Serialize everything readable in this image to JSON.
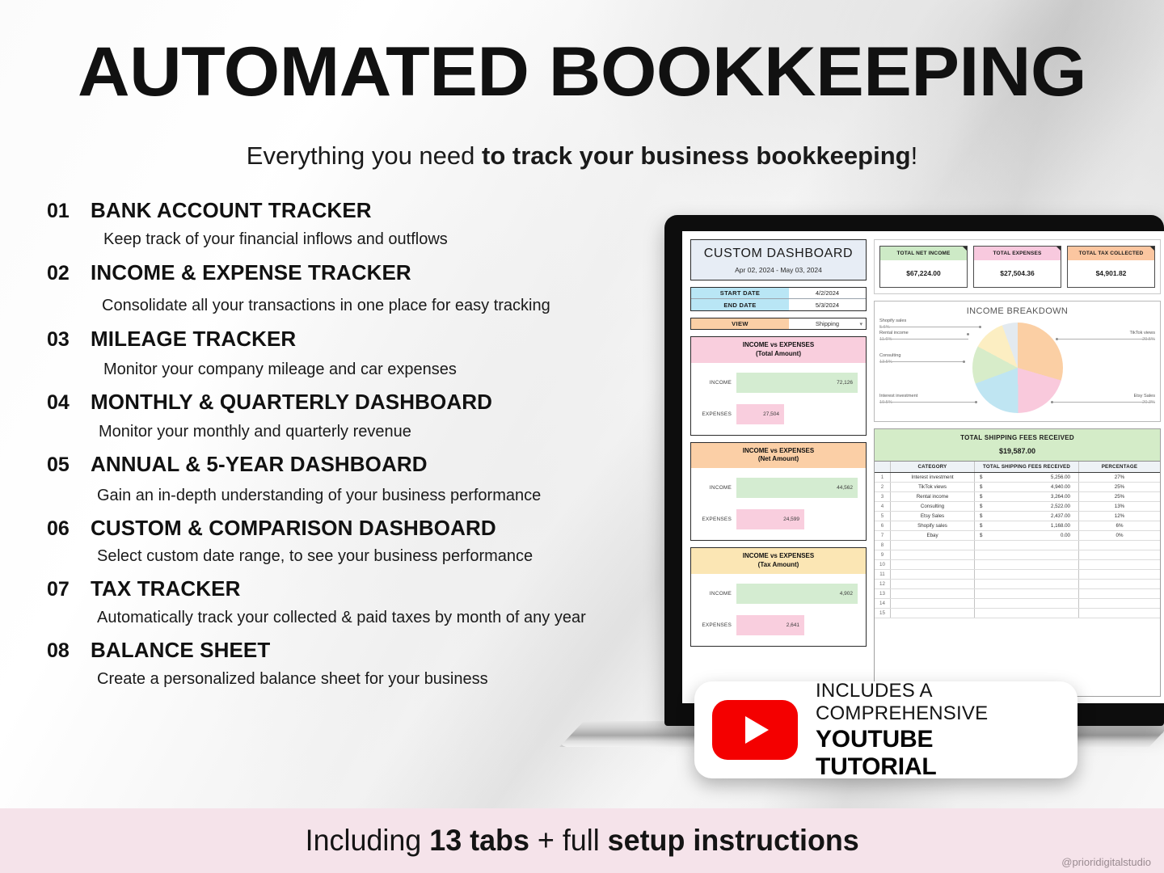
{
  "header": {
    "title": "AUTOMATED BOOKKEEPING",
    "subtitle_plain": "Everything you need ",
    "subtitle_bold": "to track your business bookkeeping",
    "subtitle_end": "!"
  },
  "features": [
    {
      "num": "01",
      "title": "BANK ACCOUNT TRACKER",
      "desc": "Keep track of your financial inflows and outflows"
    },
    {
      "num": "02",
      "title": "INCOME & EXPENSE TRACKER",
      "desc": "Consolidate all your transactions in one place for easy tracking"
    },
    {
      "num": "03",
      "title": "MILEAGE TRACKER",
      "desc": "Monitor your company mileage and car expenses"
    },
    {
      "num": "04",
      "title": "MONTHLY & QUARTERLY DASHBOARD",
      "desc": "Monitor your monthly and quarterly revenue"
    },
    {
      "num": "05",
      "title": "ANNUAL & 5-YEAR DASHBOARD",
      "desc": "Gain an in-depth understanding of your business performance"
    },
    {
      "num": "06",
      "title": "CUSTOM & COMPARISON DASHBOARD",
      "desc": "Select custom date range, to see your business performance"
    },
    {
      "num": "07",
      "title": "TAX TRACKER",
      "desc": "Automatically track your collected & paid taxes by month of any year"
    },
    {
      "num": "08",
      "title": "BALANCE SHEET",
      "desc": "Create a personalized balance sheet for your business"
    }
  ],
  "dashboard": {
    "title": "CUSTOM DASHBOARD",
    "date_range": "Apr 02, 2024 - May 03, 2024",
    "start_date_label": "START DATE",
    "start_date_value": "4/2/2024",
    "end_date_label": "END DATE",
    "end_date_value": "5/3/2024",
    "view_label": "VIEW",
    "view_value": "Shipping",
    "kpis": [
      {
        "label": "TOTAL NET INCOME",
        "value": "$67,224.00",
        "color": "#cdeac6"
      },
      {
        "label": "TOTAL EXPENSES",
        "value": "$27,504.36",
        "color": "#f8c9de"
      },
      {
        "label": "TOTAL TAX COLLECTED",
        "value": "$4,901.82",
        "color": "#fbc6a0"
      }
    ],
    "income_vs_expenses": [
      {
        "title": "INCOME vs EXPENSES",
        "subtitle": "(Total Amount)",
        "income_label": "INCOME",
        "income_value": "72,126",
        "expenses_label": "EXPENSES",
        "expenses_value": "27,504"
      },
      {
        "title": "INCOME vs EXPENSES",
        "subtitle": "(Net Amount)",
        "income_label": "INCOME",
        "income_value": "44,562",
        "expenses_label": "EXPENSES",
        "expenses_value": "24,599"
      },
      {
        "title": "INCOME vs EXPENSES",
        "subtitle": "(Tax Amount)",
        "income_label": "INCOME",
        "income_value": "4,902",
        "expenses_label": "EXPENSES",
        "expenses_value": "2,641"
      }
    ],
    "shipping": {
      "title": "TOTAL SHIPPING FEES RECEIVED",
      "total": "$19,587.00",
      "columns": [
        "",
        "CATEGORY",
        "TOTAL SHIPPING FEES RECEIVED",
        "PERCENTAGE"
      ],
      "rows": [
        {
          "idx": "1",
          "category": "Interest investment",
          "cur": "$",
          "fee": "5,256.00",
          "pct": "27%"
        },
        {
          "idx": "2",
          "category": "TikTok views",
          "cur": "$",
          "fee": "4,940.00",
          "pct": "25%"
        },
        {
          "idx": "3",
          "category": "Rental income",
          "cur": "$",
          "fee": "3,264.00",
          "pct": "25%"
        },
        {
          "idx": "4",
          "category": "Consulting",
          "cur": "$",
          "fee": "2,522.00",
          "pct": "13%"
        },
        {
          "idx": "5",
          "category": "Etsy Sales",
          "cur": "$",
          "fee": "2,437.00",
          "pct": "12%"
        },
        {
          "idx": "6",
          "category": "Shopify sales",
          "cur": "$",
          "fee": "1,168.00",
          "pct": "6%"
        },
        {
          "idx": "7",
          "category": "Ebay",
          "cur": "$",
          "fee": "0.00",
          "pct": "0%"
        },
        {
          "idx": "8",
          "category": "",
          "cur": "",
          "fee": "",
          "pct": ""
        },
        {
          "idx": "9",
          "category": "",
          "cur": "",
          "fee": "",
          "pct": ""
        },
        {
          "idx": "10",
          "category": "",
          "cur": "",
          "fee": "",
          "pct": ""
        },
        {
          "idx": "11",
          "category": "",
          "cur": "",
          "fee": "",
          "pct": ""
        },
        {
          "idx": "12",
          "category": "",
          "cur": "",
          "fee": "",
          "pct": ""
        },
        {
          "idx": "13",
          "category": "",
          "cur": "",
          "fee": "",
          "pct": ""
        },
        {
          "idx": "14",
          "category": "",
          "cur": "",
          "fee": "",
          "pct": ""
        },
        {
          "idx": "15",
          "category": "",
          "cur": "",
          "fee": "",
          "pct": ""
        }
      ]
    }
  },
  "chart_data": {
    "type": "pie",
    "title": "INCOME BREAKDOWN",
    "legend_position": "callout-labels",
    "categories": [
      "TikTok views",
      "Etsy Sales",
      "Interest investment",
      "Consulting",
      "Rental income",
      "Shopify sales"
    ],
    "values": [
      29.5,
      20.3,
      19.5,
      13.5,
      11.6,
      5.6
    ],
    "labels": [
      "29.5%",
      "20.3%",
      "19.5%",
      "13.5%",
      "11.6%",
      "5.6%"
    ],
    "colors": [
      "#fbcfa4",
      "#f9c9dc",
      "#bfe5f2",
      "#d7ecc9",
      "#fceec2",
      "#e3eaf0"
    ]
  },
  "youtube_badge": {
    "line1": "INCLUDES A COMPREHENSIVE",
    "line2": "YOUTUBE TUTORIAL",
    "icon": "youtube-play-icon"
  },
  "footer": {
    "text_plain_1": "Including ",
    "text_bold_1": "13 tabs",
    "text_plain_2": " + full ",
    "text_bold_2": "setup instructions",
    "watermark": "@prioridigitalstudio"
  }
}
